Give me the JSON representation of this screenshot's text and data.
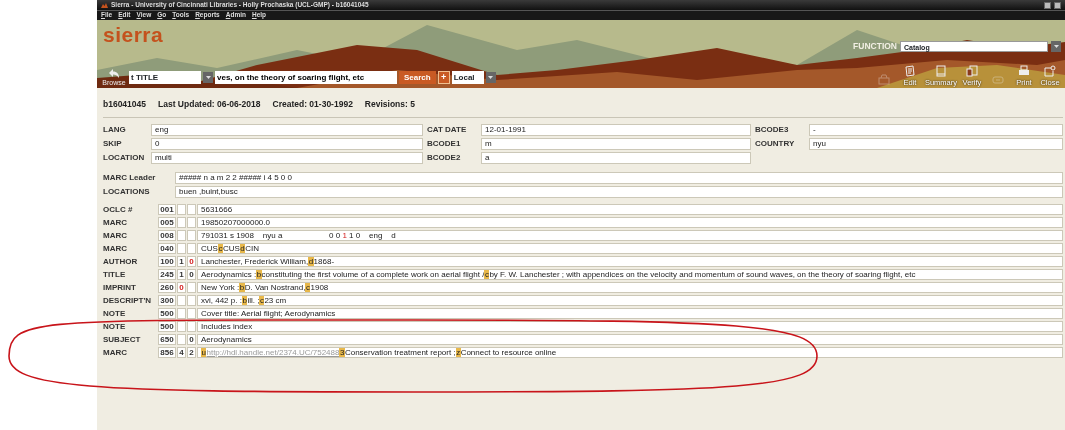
{
  "window": {
    "title": "Sierra - University of Cincinnati Libraries - Holly Prochaska (UCL-GMP) - b16041045"
  },
  "menu": [
    "File",
    "Edit",
    "View",
    "Go",
    "Tools",
    "Reports",
    "Admin",
    "Help"
  ],
  "logo": "sierra",
  "function": {
    "label": "FUNCTION",
    "value": "Catalog"
  },
  "search": {
    "back_label": "Browse",
    "index": "t TITLE",
    "query": "ves, on the theory of soaring flight, etc",
    "button": "Search",
    "plus": "+",
    "scope": "Local"
  },
  "toolbar": [
    {
      "kind": "save",
      "disabled": true
    },
    {
      "kind": "edit",
      "label": "Edit",
      "disabled": false
    },
    {
      "kind": "summary",
      "label": "Summary",
      "disabled": false
    },
    {
      "kind": "verify",
      "label": "Verify",
      "disabled": false
    },
    {
      "kind": "link",
      "disabled": true
    },
    {
      "kind": "print",
      "label": "Print",
      "disabled": false
    },
    {
      "kind": "close",
      "label": "Close",
      "disabled": false
    }
  ],
  "record": {
    "id": "b16041045",
    "updated": "Last Updated: 06-06-2018",
    "created": "Created: 01-30-1992",
    "revisions": "Revisions: 5"
  },
  "fixed_fields": [
    {
      "label": "LANG",
      "value": "eng"
    },
    {
      "label": "CAT DATE",
      "value": "12-01-1991"
    },
    {
      "label": "BCODE3",
      "value": "-"
    },
    {
      "label": "SKIP",
      "value": "0"
    },
    {
      "label": "BCODE1",
      "value": "m"
    },
    {
      "label": "COUNTRY",
      "value": "nyu"
    },
    {
      "label": "LOCATION",
      "value": "multi"
    },
    {
      "label": "BCODE2",
      "value": "a"
    }
  ],
  "leader": {
    "label": "MARC Leader",
    "value": "##### n a m   2 2 ##### i   4 5 0 0"
  },
  "locations": {
    "label": "LOCATIONS",
    "value": "buen ,buint,busc"
  },
  "fields": [
    {
      "label": "OCLC #",
      "tag": "001",
      "parts": [
        {
          "kind": "text",
          "text": "5631666"
        }
      ]
    },
    {
      "label": "MARC",
      "tag": "005",
      "parts": [
        {
          "kind": "text",
          "text": "19850207000000.0"
        }
      ]
    },
    {
      "label": "MARC",
      "tag": "008",
      "parts": [
        {
          "kind": "text",
          "text": "791031 s 1908    nyu a                     0 0 "
        },
        {
          "kind": "flagged",
          "text": "1"
        },
        {
          "kind": "text",
          "text": " 1 0    eng    d"
        }
      ]
    },
    {
      "label": "MARC",
      "tag": "040",
      "parts": [
        {
          "kind": "text",
          "text": "CUS"
        },
        {
          "kind": "subfield",
          "text": "c"
        },
        {
          "kind": "text",
          "text": "CUS"
        },
        {
          "kind": "subfield",
          "text": "d"
        },
        {
          "kind": "text",
          "text": "CIN"
        }
      ]
    },
    {
      "label": "AUTHOR",
      "tag": "100",
      "ind1": {
        "text": "1",
        "flagged": false
      },
      "ind2": {
        "text": "0",
        "flagged": true
      },
      "parts": [
        {
          "kind": "text",
          "text": "Lanchester, Frederick William,"
        },
        {
          "kind": "subfield",
          "text": "d"
        },
        {
          "kind": "text",
          "text": "1868-"
        }
      ]
    },
    {
      "label": "TITLE",
      "tag": "245",
      "ind1": {
        "text": "1",
        "flagged": false
      },
      "ind2": {
        "text": "0",
        "flagged": false
      },
      "parts": [
        {
          "kind": "text",
          "text": "Aerodynamics :"
        },
        {
          "kind": "subfield",
          "text": "b"
        },
        {
          "kind": "text",
          "text": "constituting the first volume of a complete work on aerial flight /"
        },
        {
          "kind": "subfield",
          "text": "c"
        },
        {
          "kind": "text",
          "text": "by F. W. Lanchester ; with appendices on the velocity and momentum of sound waves, on the theory of soaring flight, etc"
        }
      ]
    },
    {
      "label": "IMPRINT",
      "tag": "260",
      "ind1": {
        "text": "0",
        "flagged": true
      },
      "parts": [
        {
          "kind": "text",
          "text": "New York :"
        },
        {
          "kind": "subfield",
          "text": "b"
        },
        {
          "kind": "text",
          "text": "D. Van Nostrand,"
        },
        {
          "kind": "subfield",
          "text": "c"
        },
        {
          "kind": "text",
          "text": "1908"
        }
      ]
    },
    {
      "label": "DESCRIPT'N",
      "tag": "300",
      "parts": [
        {
          "kind": "text",
          "text": "xvi, 442 p. :"
        },
        {
          "kind": "subfield",
          "text": "b"
        },
        {
          "kind": "text",
          "text": "ill. ;"
        },
        {
          "kind": "subfield",
          "text": "c"
        },
        {
          "kind": "text",
          "text": "23 cm"
        }
      ]
    },
    {
      "label": "NOTE",
      "tag": "500",
      "parts": [
        {
          "kind": "text",
          "text": "Cover title: Aerial flight; Aerodynamics"
        }
      ]
    },
    {
      "label": "NOTE",
      "tag": "500",
      "parts": [
        {
          "kind": "text",
          "text": "Includes index"
        }
      ]
    },
    {
      "label": "SUBJECT",
      "tag": "650",
      "ind2": {
        "text": "0",
        "flagged": false
      },
      "parts": [
        {
          "kind": "text",
          "text": "Aerodynamics"
        }
      ]
    },
    {
      "label": "MARC",
      "tag": "856",
      "ind1": {
        "text": "4",
        "flagged": false
      },
      "ind2": {
        "text": "2",
        "flagged": false
      },
      "parts": [
        {
          "kind": "subfield",
          "text": "u"
        },
        {
          "kind": "link",
          "text": "http://hdl.handle.net/2374.UC/752488"
        },
        {
          "kind": "subfield",
          "text": "3"
        },
        {
          "kind": "text",
          "text": "Conservation treatment report ;"
        },
        {
          "kind": "subfield",
          "text": "z"
        },
        {
          "kind": "text",
          "text": "Connect to resource online"
        }
      ]
    }
  ],
  "annotation": {
    "kind": "ellipse"
  }
}
